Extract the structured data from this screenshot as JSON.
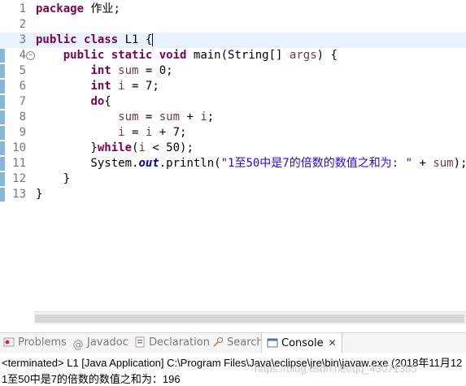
{
  "editor": {
    "lines": [
      {
        "no": "1",
        "tokens": [
          {
            "t": "kw",
            "v": "package"
          },
          {
            "t": "plain",
            "v": " 作业;"
          }
        ]
      },
      {
        "no": "2",
        "tokens": []
      },
      {
        "no": "3",
        "tokens": [
          {
            "t": "kw",
            "v": "public"
          },
          {
            "t": "plain",
            "v": " "
          },
          {
            "t": "kw",
            "v": "class"
          },
          {
            "t": "plain",
            "v": " L1 {"
          }
        ]
      },
      {
        "no": "4",
        "tokens": [
          {
            "t": "plain",
            "v": "    "
          },
          {
            "t": "kw",
            "v": "public"
          },
          {
            "t": "plain",
            "v": " "
          },
          {
            "t": "kw",
            "v": "static"
          },
          {
            "t": "plain",
            "v": " "
          },
          {
            "t": "kw",
            "v": "void"
          },
          {
            "t": "plain",
            "v": " main(String[] "
          },
          {
            "t": "var",
            "v": "args"
          },
          {
            "t": "plain",
            "v": ") {"
          }
        ]
      },
      {
        "no": "5",
        "tokens": [
          {
            "t": "plain",
            "v": "        "
          },
          {
            "t": "kw",
            "v": "int"
          },
          {
            "t": "plain",
            "v": " "
          },
          {
            "t": "var",
            "v": "sum"
          },
          {
            "t": "plain",
            "v": " = 0;"
          }
        ]
      },
      {
        "no": "6",
        "tokens": [
          {
            "t": "plain",
            "v": "        "
          },
          {
            "t": "kw",
            "v": "int"
          },
          {
            "t": "plain",
            "v": " "
          },
          {
            "t": "var",
            "v": "i"
          },
          {
            "t": "plain",
            "v": " = 7;"
          }
        ]
      },
      {
        "no": "7",
        "tokens": [
          {
            "t": "plain",
            "v": "        "
          },
          {
            "t": "kw",
            "v": "do"
          },
          {
            "t": "plain",
            "v": "{"
          }
        ]
      },
      {
        "no": "8",
        "tokens": [
          {
            "t": "plain",
            "v": "            "
          },
          {
            "t": "var",
            "v": "sum"
          },
          {
            "t": "plain",
            "v": " = "
          },
          {
            "t": "var",
            "v": "sum"
          },
          {
            "t": "plain",
            "v": " + "
          },
          {
            "t": "var",
            "v": "i"
          },
          {
            "t": "plain",
            "v": ";"
          }
        ]
      },
      {
        "no": "9",
        "tokens": [
          {
            "t": "plain",
            "v": "            "
          },
          {
            "t": "var",
            "v": "i"
          },
          {
            "t": "plain",
            "v": " = "
          },
          {
            "t": "var",
            "v": "i"
          },
          {
            "t": "plain",
            "v": " + 7;"
          }
        ]
      },
      {
        "no": "10",
        "tokens": [
          {
            "t": "plain",
            "v": "        }"
          },
          {
            "t": "kw",
            "v": "while"
          },
          {
            "t": "plain",
            "v": "("
          },
          {
            "t": "var",
            "v": "i"
          },
          {
            "t": "plain",
            "v": " < 50);"
          }
        ]
      },
      {
        "no": "11",
        "tokens": [
          {
            "t": "plain",
            "v": "        System."
          },
          {
            "t": "field",
            "v": "out"
          },
          {
            "t": "plain",
            "v": ".println("
          },
          {
            "t": "str",
            "v": "\"1至50中是7的倍数的数值之和为: \""
          },
          {
            "t": "plain",
            "v": " + "
          },
          {
            "t": "var",
            "v": "sum"
          },
          {
            "t": "plain",
            "v": ");"
          }
        ]
      },
      {
        "no": "12",
        "tokens": [
          {
            "t": "plain",
            "v": "    }"
          }
        ]
      },
      {
        "no": "13",
        "tokens": [
          {
            "t": "plain",
            "v": "}"
          }
        ]
      }
    ],
    "current_line": 3,
    "fold_marker": "⊖"
  },
  "views": {
    "tabs": [
      {
        "label": "Problems",
        "icon": "problems-icon",
        "active": false
      },
      {
        "label": "Javadoc",
        "icon": "at-icon",
        "active": false
      },
      {
        "label": "Declaration",
        "icon": "declaration-icon",
        "active": false
      },
      {
        "label": "Search",
        "icon": "search-icon",
        "active": false
      },
      {
        "label": "Console",
        "icon": "console-icon",
        "active": true
      }
    ],
    "close_glyph": "✕"
  },
  "console": {
    "status": "<terminated> L1 [Java Application] C:\\Program Files\\Java\\eclipse\\jre\\bin\\javaw.exe (2018年11月12",
    "output": "1至50中是7的倍数的数值之和为：196",
    "watermark": "https://blog.csdn.net/qq_43071355"
  },
  "colors": {
    "keyword": "#7f0055",
    "variable": "#6a3e3e",
    "field": "#0000c0",
    "string": "#2a00ff",
    "current_line": "#e8f2fe",
    "ruler": "#8ab4d8"
  }
}
